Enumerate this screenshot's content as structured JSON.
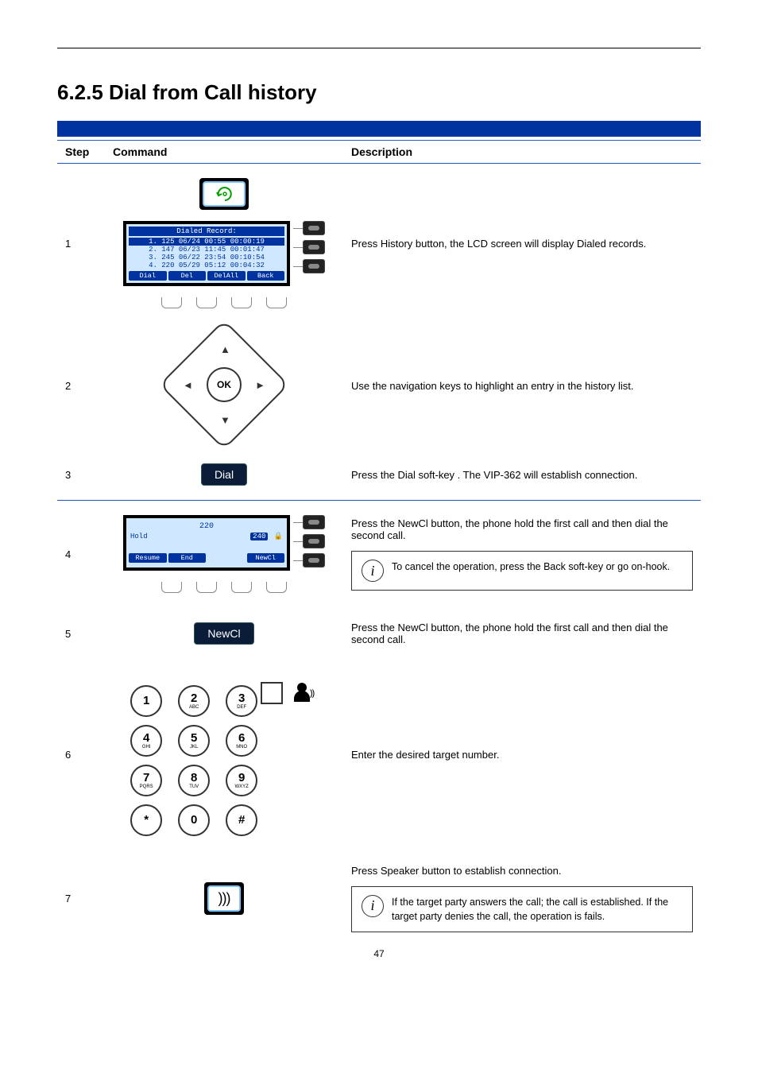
{
  "section_title": "6.2.5 Dial from Call history",
  "table_headers": {
    "step": "Step",
    "command": "Command",
    "description": "Description"
  },
  "steps": {
    "s1": {
      "num": "1",
      "desc": "Press History button, the LCD screen will display Dialed records."
    },
    "s2": {
      "num": "2",
      "desc": "Use the navigation keys to highlight an entry in the history list.",
      "ok_label": "OK"
    },
    "s3": {
      "num": "3",
      "desc": "Press the Dial soft-key . The VIP-362 will establish connection.",
      "btn_label": "Dial"
    },
    "s4": {
      "num": "4",
      "desc": "Press the NewCl button, the phone hold the first call and then dial the second call.",
      "info": "To cancel the operation, press the Back soft-key or go on-hook."
    },
    "s5": {
      "num": "5",
      "desc": "Press the NewCl button, the phone hold the first call and then dial the second call.",
      "btn_label": "NewCl"
    },
    "s6": {
      "num": "6",
      "desc": "Enter the desired target number."
    },
    "s7": {
      "num": "7",
      "desc": "Press Speaker button to establish connection.",
      "info": "If the target party answers the call; the call is established. If the target party denies the call, the operation is fails."
    }
  },
  "lcd1": {
    "title": "Dialed Record:",
    "rows": [
      "1. 125 06/24 00:55 00:00:19",
      "2. 147 06/23 11:45 00:01:47",
      "3. 245 06/22 23:54 00:10:54",
      "4. 220 05/29 05:12 00:04:32"
    ],
    "soft": [
      "Dial",
      "Del",
      "DelAll",
      "Back"
    ]
  },
  "lcd2": {
    "ext": "220",
    "status": "Hold",
    "badge": "240",
    "lock": "🔒",
    "soft": [
      "Resume",
      "End",
      "",
      "NewCl"
    ]
  },
  "keypad": {
    "k1": {
      "n": "1",
      "s": ""
    },
    "k2": {
      "n": "2",
      "s": "ABC"
    },
    "k3": {
      "n": "3",
      "s": "DEF"
    },
    "k4": {
      "n": "4",
      "s": "GHI"
    },
    "k5": {
      "n": "5",
      "s": "JKL"
    },
    "k6": {
      "n": "6",
      "s": "MNO"
    },
    "k7": {
      "n": "7",
      "s": "PQRS"
    },
    "k8": {
      "n": "8",
      "s": "TUV"
    },
    "k9": {
      "n": "9",
      "s": "WXYZ"
    },
    "kst": {
      "n": "*",
      "s": ""
    },
    "k0": {
      "n": "0",
      "s": ""
    },
    "kp": {
      "n": "#",
      "s": ""
    }
  },
  "page_num": "47",
  "speaker_glyph": ")))"
}
